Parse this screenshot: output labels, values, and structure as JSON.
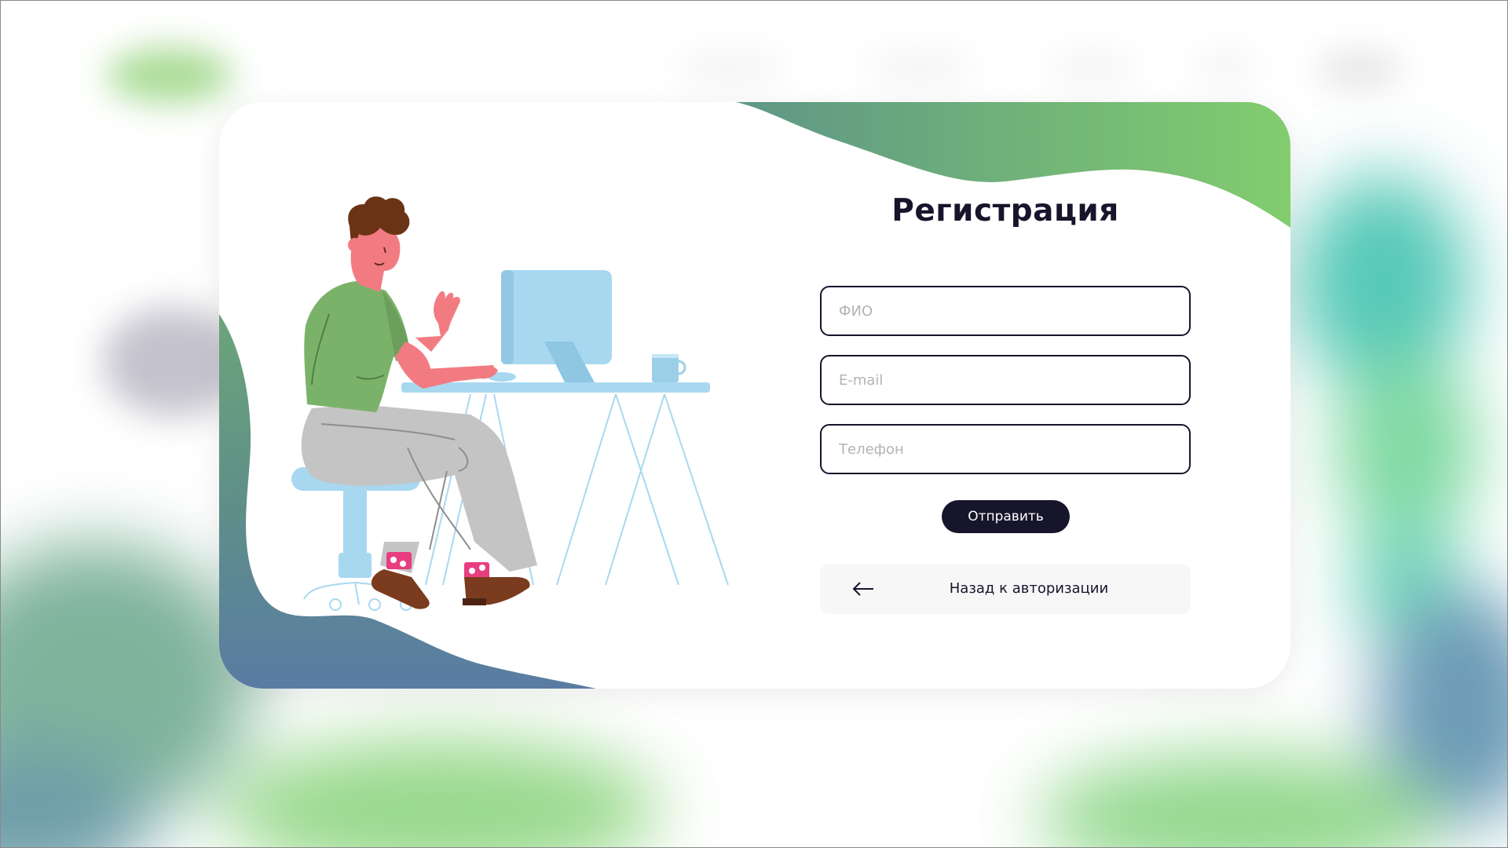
{
  "page": {
    "background_accent_colors": [
      "#83d46f",
      "#4fc4b3",
      "#5a7fa8"
    ]
  },
  "registration": {
    "title": "Регистрация",
    "fields": {
      "full_name": {
        "placeholder": "ФИО",
        "value": ""
      },
      "email": {
        "placeholder": "E-mail",
        "value": ""
      },
      "phone": {
        "placeholder": "Телефон",
        "value": ""
      }
    },
    "submit_label": "Отправить",
    "back_label": "Назад к авторизации",
    "back_icon": "arrow-left-icon"
  },
  "illustration": {
    "subject": "person-at-computer-illustration"
  },
  "colors": {
    "primary_dark": "#16152b",
    "accent_green": "#83cc6f",
    "accent_blue": "#5a7fa8",
    "monitor_blue": "#a8d8f0"
  }
}
